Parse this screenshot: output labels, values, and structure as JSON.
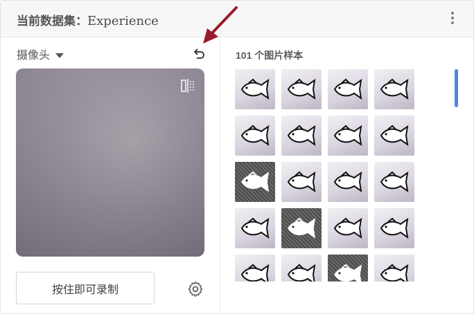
{
  "header": {
    "title_label": "当前数据集：",
    "dataset_name": "Experience"
  },
  "webcam": {
    "source_label": "摄像头"
  },
  "controls": {
    "record_label": "按住即可录制"
  },
  "samples": {
    "count_label": "101 个图片样本",
    "thumbs": [
      "light",
      "light",
      "light",
      "light",
      "light",
      "light",
      "light",
      "light",
      "dark",
      "light",
      "light",
      "light",
      "light",
      "dark",
      "light",
      "light",
      "light",
      "light",
      "dark",
      "light"
    ]
  },
  "icons": {
    "more": "more-vertical-icon",
    "undo": "undo-icon",
    "flip": "flip-horizontal-icon",
    "settings": "gear-icon",
    "dropdown": "caret-down-icon"
  },
  "colors": {
    "accent": "#4a86e8",
    "annotation_arrow": "#9b1b2a"
  }
}
